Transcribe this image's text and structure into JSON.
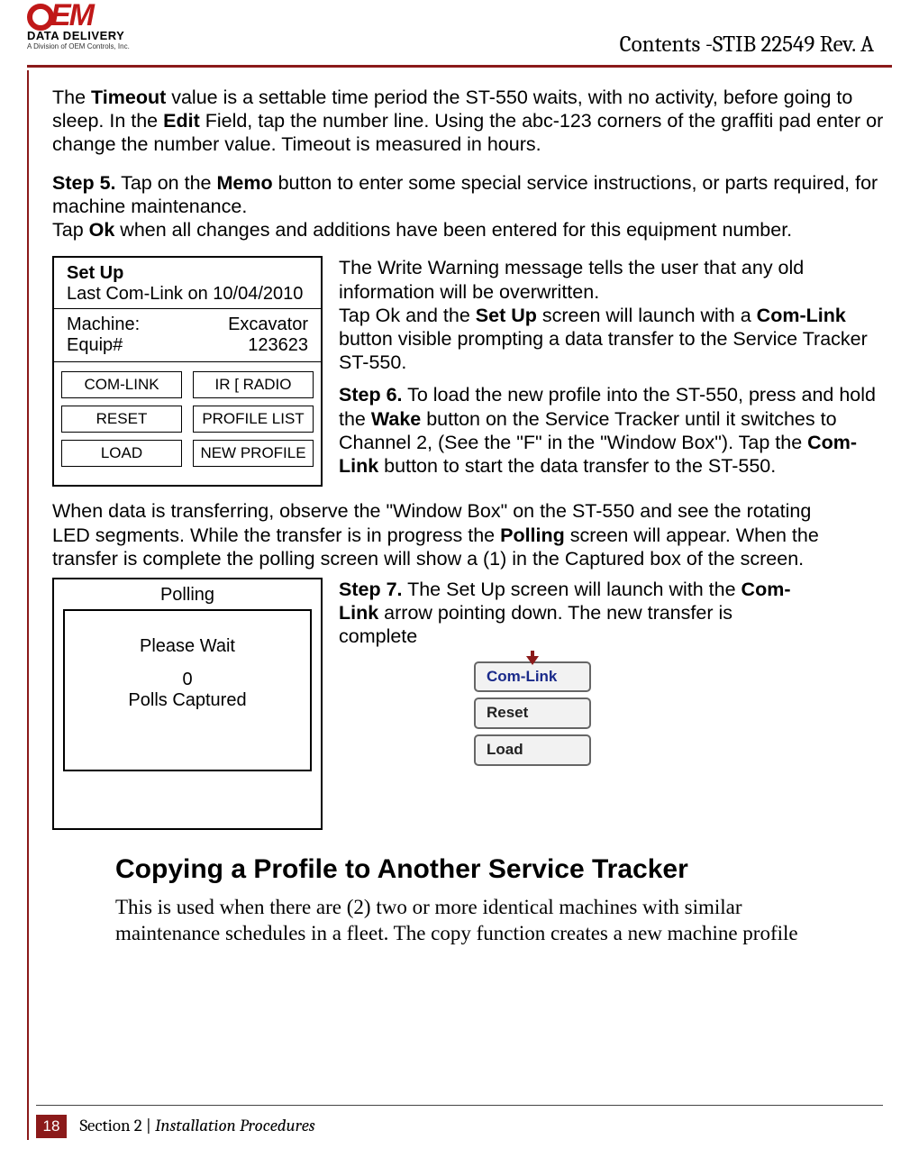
{
  "header": {
    "logo_line1": "OEM",
    "logo_line2": "DATA DELIVERY",
    "logo_line3": "A Division of OEM Controls, Inc.",
    "title": "Contents -STIB 22549 Rev. A"
  },
  "p1_pre": "The ",
  "p1_b1": "Timeout",
  "p1_mid": " value is a settable time period the ST-550 waits, with no activity, before going to sleep. In the ",
  "p1_b2": "Edit",
  "p1_post": " Field, tap the number line. Using the abc-123 corners of the graffiti pad enter or change the number value.  Timeout is measured in hours.",
  "p2_b": "Step 5.",
  "p2_mid": " Tap on the ",
  "p2_b2": "Memo",
  "p2_post": " button to enter some special service instructions, or parts required, for machine maintenance.",
  "p3_pre": "Tap ",
  "p3_b": "Ok",
  "p3_post": " when all changes and additions have been entered for this equipment number.",
  "setup": {
    "title": "Set Up",
    "sub": "Last Com-Link on 10/04/2010",
    "machine_lbl": "Machine:",
    "machine_val": "Excavator",
    "equip_lbl": "Equip#",
    "equip_val": "123623",
    "buttons": {
      "comlink": "COM-LINK",
      "irradio": "IR [ RADIO",
      "reset": "RESET",
      "profilelist": "PROFILE LIST",
      "load": "LOAD",
      "newprofile": "NEW PROFILE"
    }
  },
  "r1a_pre": "The Write Warning message tells the user that any old information will be overwritten.",
  "r1b_pre": "Tap Ok and the ",
  "r1b_b1": "Set Up",
  "r1b_mid": " screen will launch with a ",
  "r1b_b2": "Com-Link",
  "r1b_post": " button visible prompting a data transfer to the Service Tracker ST-550.",
  "r1c_b": "Step 6.",
  "r1c_mid": " To load the new profile into the ST-550, press and hold the ",
  "r1c_b2": "Wake",
  "r1c_mid2": " button on the Service Tracker until it switches to Channel 2, (See the \"F\" in the \"Window Box\"). Tap the ",
  "r1c_b3": "Com-Link",
  "r1c_post": " button to start the data transfer to the ST-550.",
  "p4_pre": "When data is transferring, observe the \"Window Box\" on the ST-550 and see the rotating LED segments. While the transfer is in progress the ",
  "p4_b": "Polling",
  "p4_post": " screen will appear. When the transfer is complete the polling screen will show a (1) in the Captured box of the screen.",
  "polling": {
    "title": "Polling",
    "wait": "Please Wait",
    "count": "0",
    "label": "Polls  Captured"
  },
  "r2_b": "Step 7.",
  "r2_mid": " The Set Up screen will launch with the ",
  "r2_b2": "Com-Link",
  "r2_post": " arrow pointing down. The new transfer is complete",
  "stack": {
    "comlink": "Com-Link",
    "reset": "Reset",
    "load": "Load"
  },
  "heading": "Copying a Profile to Another Service Tracker",
  "body": "This is used when there are (2) two or more identical machines with similar maintenance schedules in a fleet. The copy function creates a new machine profile",
  "footer": {
    "page": "18",
    "section": "Section 2 | ",
    "section_i": "Installation Procedures"
  }
}
